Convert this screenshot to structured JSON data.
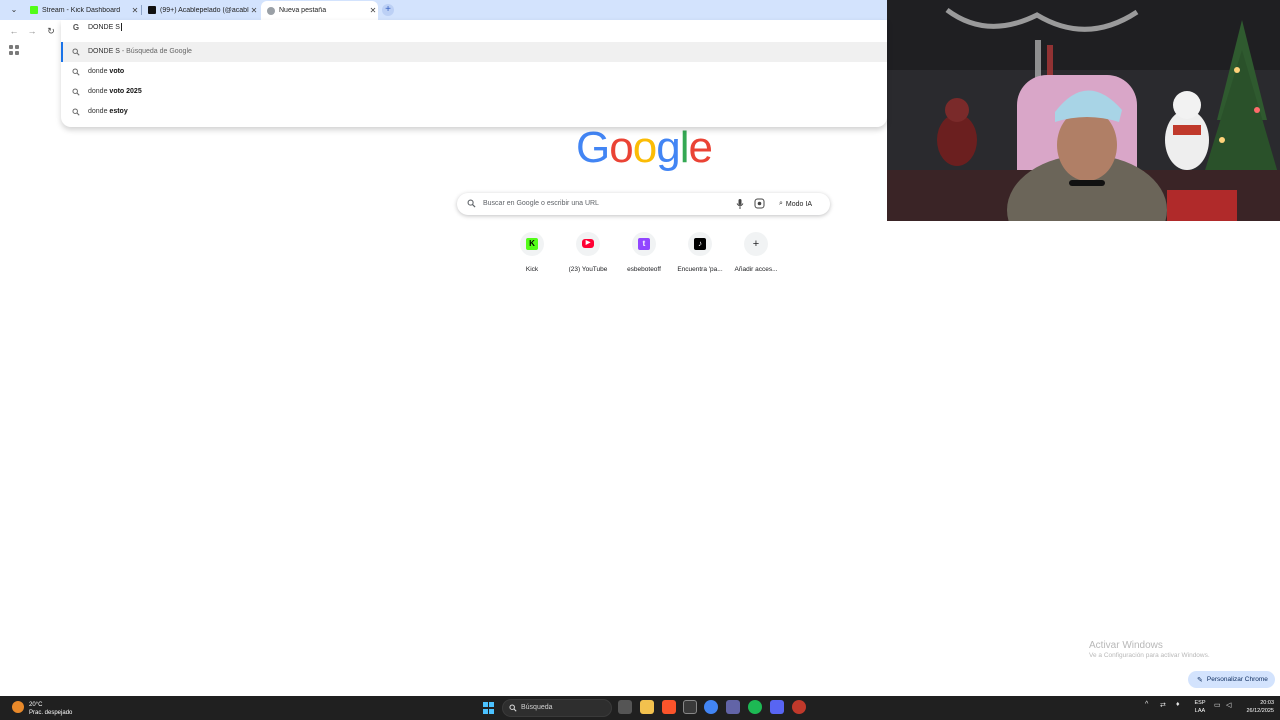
{
  "browser": {
    "tabs": [
      {
        "title": "Stream - Kick Dashboard",
        "favicon": "kick-icon",
        "active": false
      },
      {
        "title": "(99+) Acablepelado (@acablep",
        "favicon": "tiktok-icon",
        "active": false
      },
      {
        "title": "Nueva pestaña",
        "favicon": "chrome-icon",
        "active": true
      }
    ],
    "new_tab": "+",
    "omnibox": {
      "value": "DONDE S",
      "suggestions": [
        {
          "prefix": "DONDE S",
          "bold": "",
          "sub": " - Búsqueda de Google",
          "selected": true
        },
        {
          "prefix": "donde ",
          "bold": "voto",
          "sub": "",
          "selected": false
        },
        {
          "prefix": "donde ",
          "bold": "voto 2025",
          "sub": "",
          "selected": false
        },
        {
          "prefix": "donde ",
          "bold": "estoy",
          "sub": "",
          "selected": false
        }
      ]
    }
  },
  "newtab": {
    "logo": {
      "letters": [
        "G",
        "o",
        "o",
        "g",
        "l",
        "e"
      ],
      "colors": [
        "#4285f4",
        "#ea4335",
        "#fbbc05",
        "#4285f4",
        "#34a853",
        "#ea4335"
      ]
    },
    "search_placeholder": "Buscar en Google o escribir una URL",
    "ai_mode": "Modo IA",
    "shortcuts": [
      {
        "label": "Kick",
        "icon": "kick-icon",
        "color": "#53fc18"
      },
      {
        "label": "(23) YouTube",
        "icon": "youtube-icon",
        "color": "#ff0033"
      },
      {
        "label": "esbeboteoff",
        "icon": "twitch-icon",
        "color": "#9146ff"
      },
      {
        "label": "Encuentra 'pa...",
        "icon": "tiktok-icon",
        "color": "#000000"
      },
      {
        "label": "Añadir acces...",
        "icon": "plus-icon",
        "color": "#f1f3f4"
      }
    ],
    "customize": "Personalizar Chrome"
  },
  "watermark": {
    "title": "Activar Windows",
    "subtitle": "Ve a Configuración para activar Windows."
  },
  "taskbar": {
    "weather_temp": "20°C",
    "weather_desc": "Prac. despejado",
    "search": "Búsqueda",
    "lang_top": "ESP",
    "lang_bottom": "LAA",
    "time": "20:03",
    "date": "26/12/2025"
  }
}
